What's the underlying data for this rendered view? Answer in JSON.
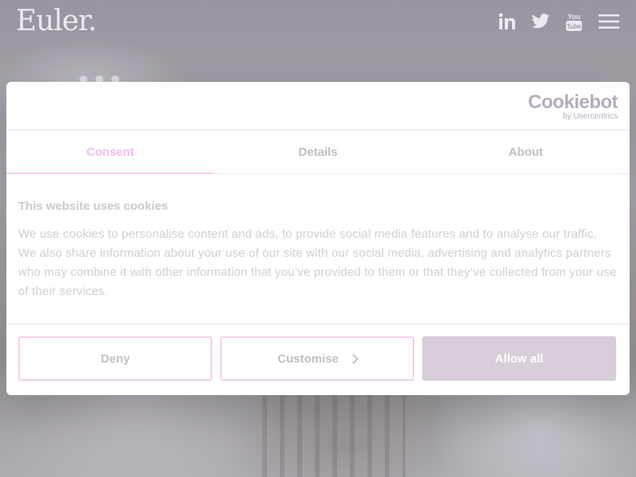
{
  "header": {
    "logo_text": "Euler.",
    "social_icons": [
      "linkedin-icon",
      "twitter-icon",
      "youtube-icon"
    ],
    "menu_icon": "hamburger-menu-icon"
  },
  "dialog": {
    "brand_name": "Cookiebot",
    "brand_sub": "by Usercentrics",
    "tabs": [
      {
        "label": "Consent",
        "active": true
      },
      {
        "label": "Details",
        "active": false
      },
      {
        "label": "About",
        "active": false
      }
    ],
    "title": "This website uses cookies",
    "body": "We use cookies to personalise content and ads, to provide social media features and to analyse our traffic. We also share information about your use of our site with our social media, advertising and analytics partners who may combine it with other information that you’ve provided to them or that they’ve collected from your use of their services.",
    "buttons": {
      "deny": "Deny",
      "customise": "Customise",
      "allow_all": "Allow all"
    }
  },
  "colors": {
    "accent_tab": "#f1b6e9",
    "outline_button_border": "#f2cdec",
    "allow_button_bg": "#d5cad7"
  }
}
